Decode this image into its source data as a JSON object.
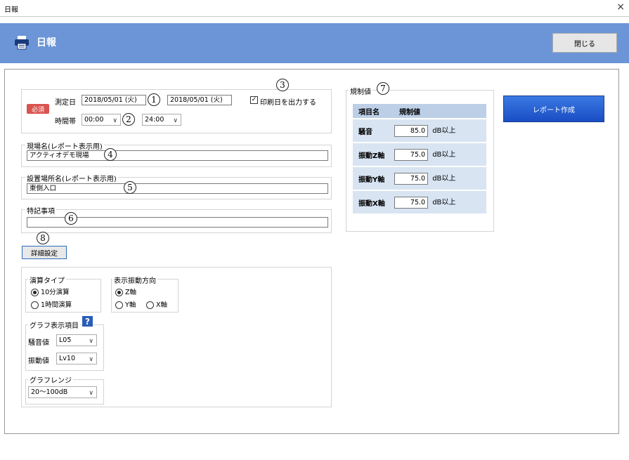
{
  "window": {
    "title": "日報",
    "close_glyph": "×"
  },
  "header": {
    "title": "日報",
    "icon": "printer-icon",
    "close_button": "閉じる"
  },
  "fields": {
    "measure_date_label": "測定日",
    "date_from": "2018/05/01 (火)",
    "date_to": "2018/05/01 (火)",
    "required_badge": "必須",
    "time_label": "時間帯",
    "time_from": "00:00",
    "time_to": "24:00",
    "print_date_label": "印刷日を出力する",
    "print_date_checked": true,
    "site_name_label": "現場名(レポート表示用)",
    "site_name_value": "アクティオデモ現場",
    "location_label": "設置場所名(レポート表示用)",
    "location_value": "東側入口",
    "remarks_label": "特記事項",
    "remarks_value": ""
  },
  "annotations": {
    "a1": "1",
    "a2": "2",
    "a3": "3",
    "a4": "4",
    "a5": "5",
    "a6": "6",
    "a7": "7",
    "a8": "8"
  },
  "regulation": {
    "label": "規制値",
    "col_item": "項目名",
    "col_value": "規制値",
    "rows": [
      {
        "name": "騒音",
        "value": "85.0",
        "unit": "dB以上"
      },
      {
        "name": "振動Z軸",
        "value": "75.0",
        "unit": "dB以上"
      },
      {
        "name": "振動Y軸",
        "value": "75.0",
        "unit": "dB以上"
      },
      {
        "name": "振動X軸",
        "value": "75.0",
        "unit": "dB以上"
      }
    ]
  },
  "report_button": "レポート作成",
  "detail_button": "詳細設定",
  "detail": {
    "calc_type_label": "演算タイプ",
    "calc_10min": "10分演算",
    "calc_1hour": "1時間演算",
    "vib_dir_label": "表示振動方向",
    "dir_z": "Z軸",
    "dir_y": "Y軸",
    "dir_x": "X軸",
    "graph_items_label": "グラフ表示項目",
    "noise_label": "騒音値",
    "noise_value": "L05",
    "vib_label": "振動値",
    "vib_value": "Lv10",
    "graph_range_label": "グラフレンジ",
    "graph_range_value": "20～100dB",
    "help_glyph": "?"
  },
  "colors": {
    "header": "#6b95d6",
    "required": "#d9534f",
    "report_button": "#2a62d4",
    "table_header": "#bccfe6",
    "table_cell": "#d8e4f2"
  }
}
